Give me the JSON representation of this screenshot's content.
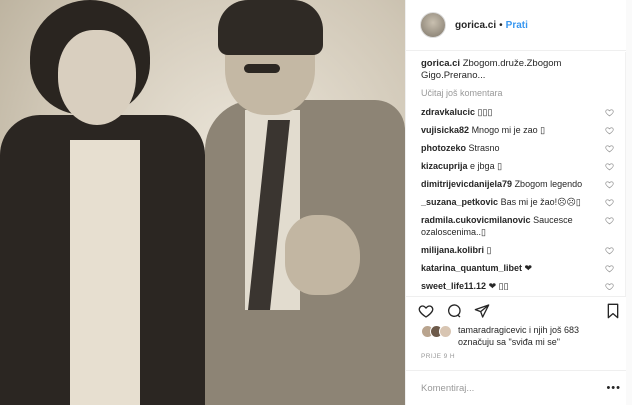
{
  "post": {
    "username": "gorica.ci",
    "follow_label": "Prati",
    "separator": "•",
    "caption_user": "gorica.ci",
    "caption_text": "Zbogom.druže.Zbogom Gigo.Prerano...",
    "load_more": "Učitaj još komentara"
  },
  "comments": [
    {
      "user": "zdravkalucic",
      "text": "▯▯▯"
    },
    {
      "user": "vujisicka82",
      "text": "Mnogo mi je zao ▯"
    },
    {
      "user": "photozeko",
      "text": "Strasno"
    },
    {
      "user": "kizacuprija",
      "text": "e jbga ▯"
    },
    {
      "user": "dimitrijevicdanijela79",
      "text": "Zbogom legendo"
    },
    {
      "user": "_suzana_petkovic",
      "text": "Bas mi je žao!☹☹▯"
    },
    {
      "user": "radmila.cukovicmilanovic",
      "text": "Saucesce ozaloscenima..▯"
    },
    {
      "user": "milijana.kolibri",
      "text": "▯"
    },
    {
      "user": "katarina_quantum_libet",
      "text": "❤"
    },
    {
      "user": "sweet_life11.12",
      "text": "❤ ▯▯"
    }
  ],
  "likes": {
    "user": "tamaradragicevic",
    "text_middle": " i njih još 683",
    "text_line2": "označuju sa \"sviđa mi se\""
  },
  "time": "PRIJE 9 H",
  "comment_box": {
    "placeholder": "Komentiraj...",
    "more": "•••"
  },
  "icons": {
    "like": "heart-icon",
    "comment": "comment-bubble-icon",
    "share": "send-icon",
    "save": "bookmark-icon"
  },
  "colors": {
    "follow": "#3897f0",
    "text": "#262626",
    "muted": "#999999"
  }
}
